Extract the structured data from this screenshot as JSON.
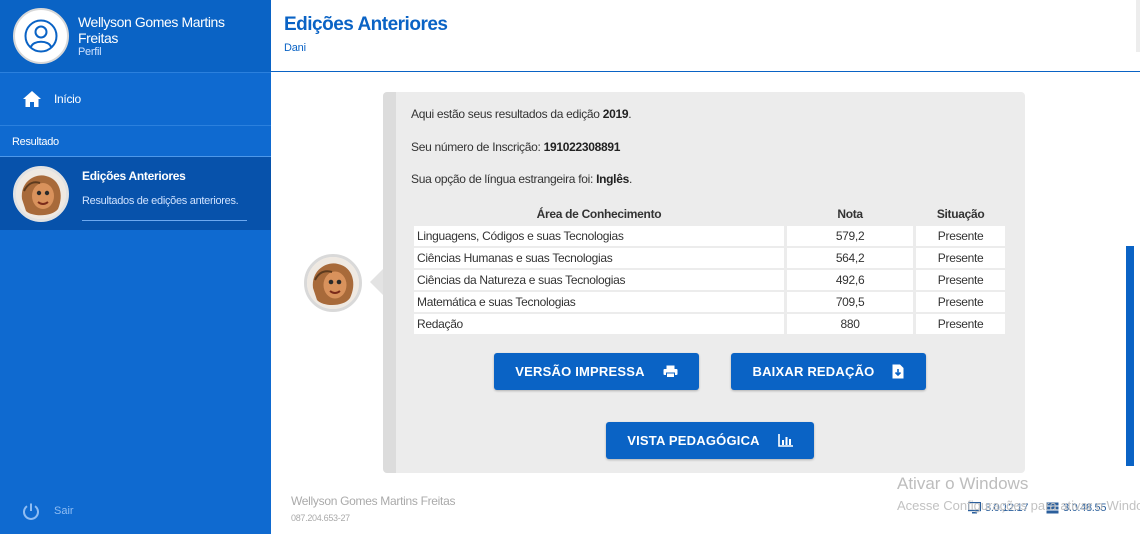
{
  "sidebar": {
    "profile_name": "Wellyson Gomes Martins Freitas",
    "profile_link": "Perfil",
    "home_label": "Início",
    "section_label": "Resultado",
    "active_title": "Edições Anteriores",
    "active_subtitle": "Resultados de edições anteriores.",
    "logout_label": "Sair"
  },
  "header": {
    "title": "Edições Anteriores",
    "subtitle": "Dani"
  },
  "message": {
    "edition_prefix": "Aqui estão seus resultados da edição",
    "edition_year": "2019",
    "inscription_prefix": "Seu número de Inscrição:",
    "inscription_number": "191022308891",
    "language_prefix": "Sua opção de língua estrangeira foi:",
    "language": "Inglês"
  },
  "table": {
    "headers": [
      "Área de Conhecimento",
      "Nota",
      "Situação"
    ],
    "rows": [
      {
        "area": "Linguagens, Códigos e suas Tecnologias",
        "nota": "579,2",
        "situacao": "Presente"
      },
      {
        "area": "Ciências Humanas e suas Tecnologias",
        "nota": "564,2",
        "situacao": "Presente"
      },
      {
        "area": "Ciências da Natureza e suas Tecnologias",
        "nota": "492,6",
        "situacao": "Presente"
      },
      {
        "area": "Matemática e suas Tecnologias",
        "nota": "709,5",
        "situacao": "Presente"
      },
      {
        "area": "Redação",
        "nota": "880",
        "situacao": "Presente"
      }
    ]
  },
  "buttons": {
    "print": "VERSÃO IMPRESSA",
    "download": "BAIXAR REDAÇÃO",
    "pedagogical": "VISTA PEDAGÓGICA"
  },
  "footer": {
    "name": "Wellyson Gomes Martins Freitas",
    "cpf": "087.204.653-27",
    "client_version": "3.0.12.17",
    "server_version": "3.0.48.55"
  },
  "watermark": {
    "title": "Ativar o Windows",
    "subtitle": "Acesse Configurações para ativar o Windows."
  },
  "colors": {
    "primary": "#0a63c5",
    "sidebar": "#0f6ad0",
    "card": "#ececec"
  }
}
